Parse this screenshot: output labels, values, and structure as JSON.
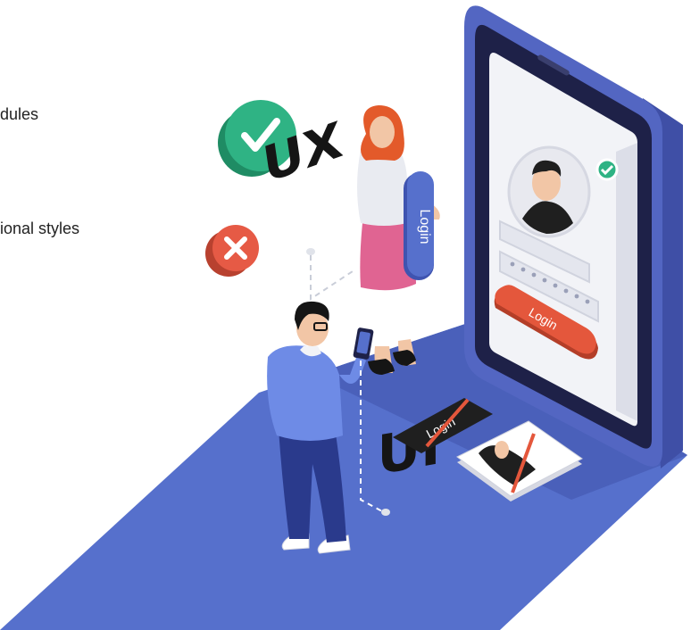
{
  "side_texts": [
    "dules",
    "ional styles"
  ],
  "scene": {
    "badge_ux": "UX",
    "badge_ui": "UI",
    "phone_login_button": "Login",
    "handheld_login_button": "Login",
    "crossed_login_card": "Login"
  },
  "colors": {
    "ground": "#5670CC",
    "phone_body": "#5366C2",
    "phone_bezel": "#1E2148",
    "screen": "#F2F3F7",
    "login_button": "#E4573C",
    "check_badge": "#2FB384",
    "cross_badge": "#E65A45"
  },
  "icons": [
    "check-icon",
    "cross-icon"
  ]
}
